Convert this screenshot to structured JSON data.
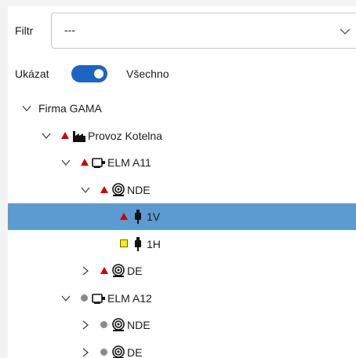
{
  "filter": {
    "label": "Filtr",
    "value": "---",
    "chevron_icon": "chevron-down-icon"
  },
  "show": {
    "label": "Ukázat",
    "toggle_on": true,
    "toggle_text": "Všechno",
    "accent": "#1d63c3"
  },
  "colors": {
    "selected_row": "#5b9bd1",
    "alarm": "#d00000",
    "warning": "#ffee00",
    "inactive": "#8a8a8a"
  },
  "tree": [
    {
      "label": "Firma GAMA",
      "level": 0,
      "expanded": true,
      "status": "none",
      "icon": "none"
    },
    {
      "label": "Provoz Kotelna",
      "level": 1,
      "expanded": true,
      "status": "alarm",
      "icon": "factory-icon"
    },
    {
      "label": "ELM A11",
      "level": 2,
      "expanded": true,
      "status": "alarm",
      "icon": "motor-icon"
    },
    {
      "label": "NDE",
      "level": 3,
      "expanded": true,
      "status": "alarm",
      "icon": "bearing-icon"
    },
    {
      "label": "1V",
      "level": 4,
      "expanded": null,
      "status": "alarm",
      "icon": "sensor-icon",
      "selected": true
    },
    {
      "label": "1H",
      "level": 4,
      "expanded": null,
      "status": "warning",
      "icon": "sensor-icon"
    },
    {
      "label": "DE",
      "level": 3,
      "expanded": false,
      "status": "alarm",
      "icon": "bearing-icon"
    },
    {
      "label": "ELM A12",
      "level": 2,
      "expanded": true,
      "status": "inactive",
      "icon": "motor-icon"
    },
    {
      "label": "NDE",
      "level": 3,
      "expanded": false,
      "status": "inactive",
      "icon": "bearing-icon"
    },
    {
      "label": "DE",
      "level": 3,
      "expanded": false,
      "status": "inactive",
      "icon": "bearing-icon"
    }
  ]
}
